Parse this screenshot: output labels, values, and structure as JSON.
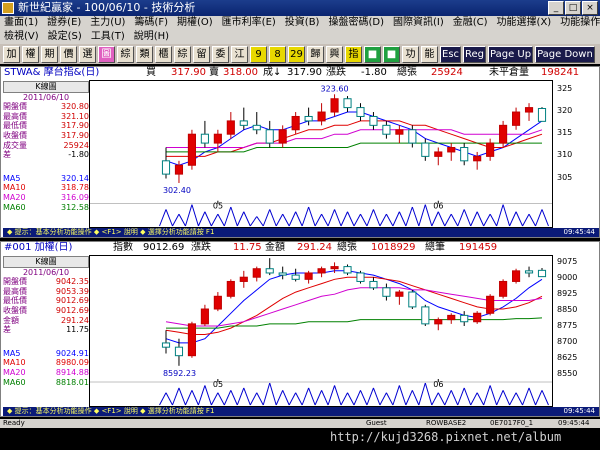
{
  "window": {
    "title": "新世紀贏家 - 100/06/10 - 技術分析"
  },
  "menu": {
    "row1": [
      "畫面(1)",
      "證券(E)",
      "主力(U)",
      "籌碼(F)",
      "期權(O)",
      "匯市利率(E)",
      "投資(B)",
      "操盤密碼(D)",
      "國際資訊(I)",
      "金融(C)",
      "功能選擇(X)",
      "功能操作(F)"
    ],
    "row2": [
      "檢視(V)",
      "設定(S)",
      "工具(T)",
      "說明(H)"
    ]
  },
  "toolbar": {
    "buttons": [
      "加",
      "權",
      "期",
      "價",
      "選",
      "圖",
      "綜",
      "類",
      "櫃",
      "綜",
      "留",
      "委",
      "江",
      "9",
      "8",
      "29",
      "歸",
      "興",
      "指",
      "■",
      "■",
      "功",
      "能",
      "Esc",
      "Reg",
      "Page Up",
      "Page Down"
    ]
  },
  "panel1": {
    "symbol": "STWA& 摩台指&(日)",
    "buy_label": "買",
    "buy": "317.90",
    "sell_label": "賣",
    "sell": "318.00",
    "deal_label": "成↓",
    "deal": "317.90",
    "chg_label": "漲跌",
    "chg": "-1.80",
    "vol_label": "總張",
    "vol": "25924",
    "oi_label": "未平倉量",
    "oi": "198241",
    "ktitle": "K線圖",
    "date": "2011/06/10",
    "info": [
      {
        "k": "開盤價",
        "v": "320.80"
      },
      {
        "k": "最高價",
        "v": "321.10"
      },
      {
        "k": "最低價",
        "v": "317.90"
      },
      {
        "k": "收盤價",
        "v": "317.90"
      },
      {
        "k": "成交量",
        "v": "25924"
      },
      {
        "k": "差",
        "v": "-1.80"
      }
    ],
    "ma": [
      {
        "k": "MA5",
        "v": "320.14"
      },
      {
        "k": "MA10",
        "v": "318.78"
      },
      {
        "k": "MA20",
        "v": "316.09"
      },
      {
        "k": "MA60",
        "v": "312.58"
      }
    ],
    "high_label": "323.60",
    "low_label": "302.40",
    "yticks": [
      "325",
      "320",
      "315",
      "310",
      "305"
    ],
    "xticks": [
      "05",
      "06"
    ],
    "status": "◆ 提示：基本分析功能操作 ◆ <F1> 說明 ◆ 選擇分析功能請按 F1",
    "time": "09:45:44"
  },
  "panel2": {
    "symbol": "#001 加權(日)",
    "idx_label": "指數",
    "idx": "9012.69",
    "chg_label": "漲跌",
    "chg": "11.75",
    "amt_label": "金額",
    "amt": "291.24",
    "vol_label": "總張",
    "vol": "1018929",
    "cnt_label": "總筆",
    "cnt": "191459",
    "ktitle": "K線圖",
    "date": "2011/06/10",
    "info": [
      {
        "k": "開盤價",
        "v": "9042.35"
      },
      {
        "k": "最高價",
        "v": "9053.39"
      },
      {
        "k": "最低價",
        "v": "9012.69"
      },
      {
        "k": "收盤價",
        "v": "9012.69"
      },
      {
        "k": "金額",
        "v": "291.24"
      },
      {
        "k": "差",
        "v": "11.75"
      }
    ],
    "ma": [
      {
        "k": "MA5",
        "v": "9024.91"
      },
      {
        "k": "MA10",
        "v": "8980.09"
      },
      {
        "k": "MA20",
        "v": "8914.88"
      },
      {
        "k": "MA60",
        "v": "8818.01"
      }
    ],
    "high_label": "9099.75",
    "low_label": "8592.23",
    "yticks": [
      "9075",
      "9000",
      "8925",
      "8850",
      "8775",
      "8700",
      "8625",
      "8550"
    ],
    "xticks": [
      "05",
      "06"
    ],
    "status": "◆ 提示：基本分析功能操作 ◆ <F1> 說明 ◆ 選擇分析功能請按 F1",
    "time": "09:45:44"
  },
  "statusbar": {
    "left": "Ready",
    "user": "Guest",
    "mid1": "ROWBASE2",
    "mid2": "0E7017F0_1",
    "time": "09:45:44"
  },
  "watermark": "http://kujd3268.pixnet.net/album",
  "colors": {
    "up": "#e00000",
    "down": "#ffffff",
    "ma5": "#0000ff",
    "ma10": "#e00000",
    "ma20": "#d000d0",
    "ma60": "#008000",
    "vol": "#0000d0"
  },
  "chart_data": [
    {
      "type": "candlestick",
      "title": "STWA& 摩台指&(日)",
      "ylim": [
        300,
        327
      ],
      "x_labels": [
        "05",
        "06"
      ],
      "ohlc": [
        [
          309,
          312,
          305,
          306
        ],
        [
          306,
          309,
          304,
          308
        ],
        [
          308,
          316,
          307,
          315
        ],
        [
          315,
          318,
          312,
          313
        ],
        [
          313,
          316,
          311,
          315
        ],
        [
          315,
          320,
          314,
          318
        ],
        [
          318,
          321,
          316,
          317
        ],
        [
          317,
          320,
          315,
          316
        ],
        [
          316,
          318,
          312,
          313
        ],
        [
          313,
          317,
          312,
          316
        ],
        [
          316,
          320,
          315,
          319
        ],
        [
          319,
          321,
          317,
          318
        ],
        [
          318,
          322,
          317,
          320
        ],
        [
          320,
          324,
          319,
          323
        ],
        [
          323,
          323.6,
          320,
          321
        ],
        [
          321,
          322,
          318,
          319
        ],
        [
          319,
          320,
          316,
          317
        ],
        [
          317,
          318,
          314,
          315
        ],
        [
          315,
          317,
          313,
          316
        ],
        [
          316,
          317,
          312,
          313
        ],
        [
          313,
          314,
          309,
          310
        ],
        [
          310,
          312,
          308,
          311
        ],
        [
          311,
          313,
          309,
          312
        ],
        [
          312,
          313,
          308,
          309
        ],
        [
          309,
          311,
          307,
          310
        ],
        [
          310,
          314,
          309,
          313
        ],
        [
          313,
          318,
          312,
          317
        ],
        [
          317,
          321,
          316,
          320
        ],
        [
          320,
          322,
          318,
          321
        ],
        [
          320.8,
          321.1,
          317.9,
          317.9
        ]
      ],
      "ma": {
        "MA5": [
          309,
          308,
          309,
          311,
          312,
          314,
          316,
          317,
          316,
          316,
          317,
          318,
          318,
          319,
          320,
          320,
          319,
          318,
          317,
          316,
          314,
          313,
          312,
          311,
          310,
          311,
          312,
          314,
          316,
          318
        ],
        "MA10": [
          310,
          310,
          310,
          310,
          311,
          311,
          312,
          313,
          313,
          314,
          315,
          316,
          316,
          317,
          317,
          318,
          318,
          318,
          318,
          317,
          317,
          316,
          315,
          314,
          313,
          312,
          312,
          313,
          314,
          315
        ],
        "MA20": [
          312,
          312,
          312,
          312,
          312,
          312,
          312,
          313,
          313,
          313,
          314,
          314,
          314,
          315,
          315,
          316,
          316,
          316,
          316,
          316,
          316,
          316,
          316,
          315,
          315,
          315,
          315,
          315,
          315,
          316
        ],
        "MA60": [
          311,
          311,
          311,
          311,
          311,
          311,
          311,
          312,
          312,
          312,
          312,
          312,
          312,
          312,
          312,
          313,
          313,
          313,
          313,
          313,
          313,
          313,
          313,
          313,
          313,
          313,
          313,
          313,
          313,
          313
        ]
      },
      "volume": [
        0.7,
        0.5,
        0.9,
        0.6,
        0.5,
        0.8,
        0.6,
        0.4,
        0.7,
        0.5,
        0.6,
        0.8,
        0.5,
        0.7,
        0.6,
        0.5,
        0.7,
        0.5,
        0.6,
        0.8,
        0.9,
        0.6,
        0.5,
        0.7,
        0.6,
        0.5,
        0.9,
        0.6,
        0.5,
        0.7
      ]
    },
    {
      "type": "candlestick",
      "title": "#001 加權(日)",
      "ylim": [
        8530,
        9110
      ],
      "x_labels": [
        "05",
        "06"
      ],
      "ohlc": [
        [
          8700,
          8760,
          8650,
          8680
        ],
        [
          8680,
          8720,
          8592.23,
          8640
        ],
        [
          8640,
          8800,
          8630,
          8790
        ],
        [
          8790,
          8880,
          8780,
          8860
        ],
        [
          8860,
          8940,
          8850,
          8920
        ],
        [
          8920,
          9000,
          8910,
          8990
        ],
        [
          8990,
          9040,
          8960,
          9010
        ],
        [
          9010,
          9060,
          8990,
          9050
        ],
        [
          9050,
          9099.75,
          9020,
          9030
        ],
        [
          9030,
          9060,
          9000,
          9020
        ],
        [
          9020,
          9050,
          8990,
          9000
        ],
        [
          9000,
          9040,
          8980,
          9030
        ],
        [
          9030,
          9060,
          9010,
          9050
        ],
        [
          9050,
          9080,
          9030,
          9060
        ],
        [
          9060,
          9070,
          9020,
          9030
        ],
        [
          9030,
          9040,
          8980,
          8990
        ],
        [
          8990,
          9010,
          8950,
          8960
        ],
        [
          8960,
          8980,
          8900,
          8920
        ],
        [
          8920,
          8950,
          8880,
          8940
        ],
        [
          8940,
          8950,
          8860,
          8870
        ],
        [
          8870,
          8880,
          8780,
          8790
        ],
        [
          8790,
          8820,
          8760,
          8810
        ],
        [
          8810,
          8840,
          8790,
          8830
        ],
        [
          8830,
          8850,
          8780,
          8800
        ],
        [
          8800,
          8850,
          8790,
          8840
        ],
        [
          8840,
          8930,
          8830,
          8920
        ],
        [
          8920,
          9000,
          8910,
          8990
        ],
        [
          8990,
          9050,
          8980,
          9040
        ],
        [
          9040,
          9060,
          9010,
          9030
        ],
        [
          9042.35,
          9053.39,
          9012.69,
          9012.69
        ]
      ],
      "ma": {
        "MA5": [
          8720,
          8700,
          8700,
          8720,
          8780,
          8840,
          8900,
          8950,
          9000,
          9020,
          9030,
          9030,
          9030,
          9040,
          9040,
          9030,
          9020,
          9000,
          8980,
          8950,
          8900,
          8870,
          8850,
          8830,
          8820,
          8840,
          8870,
          8910,
          8960,
          9000
        ],
        "MA10": [
          8760,
          8750,
          8740,
          8740,
          8750,
          8770,
          8800,
          8830,
          8870,
          8910,
          8940,
          8960,
          8980,
          9000,
          9010,
          9010,
          9010,
          9000,
          8990,
          8970,
          8950,
          8930,
          8910,
          8890,
          8870,
          8860,
          8860,
          8870,
          8890,
          8920
        ],
        "MA20": [
          8800,
          8790,
          8780,
          8780,
          8780,
          8790,
          8800,
          8820,
          8840,
          8860,
          8880,
          8900,
          8920,
          8930,
          8950,
          8960,
          8960,
          8960,
          8960,
          8950,
          8950,
          8940,
          8930,
          8920,
          8910,
          8900,
          8900,
          8900,
          8900,
          8910
        ],
        "MA60": [
          8770,
          8770,
          8770,
          8770,
          8770,
          8780,
          8780,
          8780,
          8790,
          8790,
          8790,
          8800,
          8800,
          8800,
          8800,
          8810,
          8810,
          8810,
          8810,
          8810,
          8810,
          8810,
          8810,
          8810,
          8810,
          8810,
          8810,
          8815,
          8815,
          8818
        ]
      },
      "volume": [
        0.5,
        0.7,
        0.6,
        0.8,
        0.5,
        0.6,
        0.7,
        0.5,
        0.9,
        0.6,
        0.5,
        0.7,
        0.6,
        0.8,
        0.5,
        0.6,
        0.7,
        0.5,
        0.8,
        0.6,
        0.9,
        0.5,
        0.6,
        0.7,
        0.5,
        0.8,
        0.6,
        0.5,
        0.7,
        0.6
      ]
    }
  ]
}
